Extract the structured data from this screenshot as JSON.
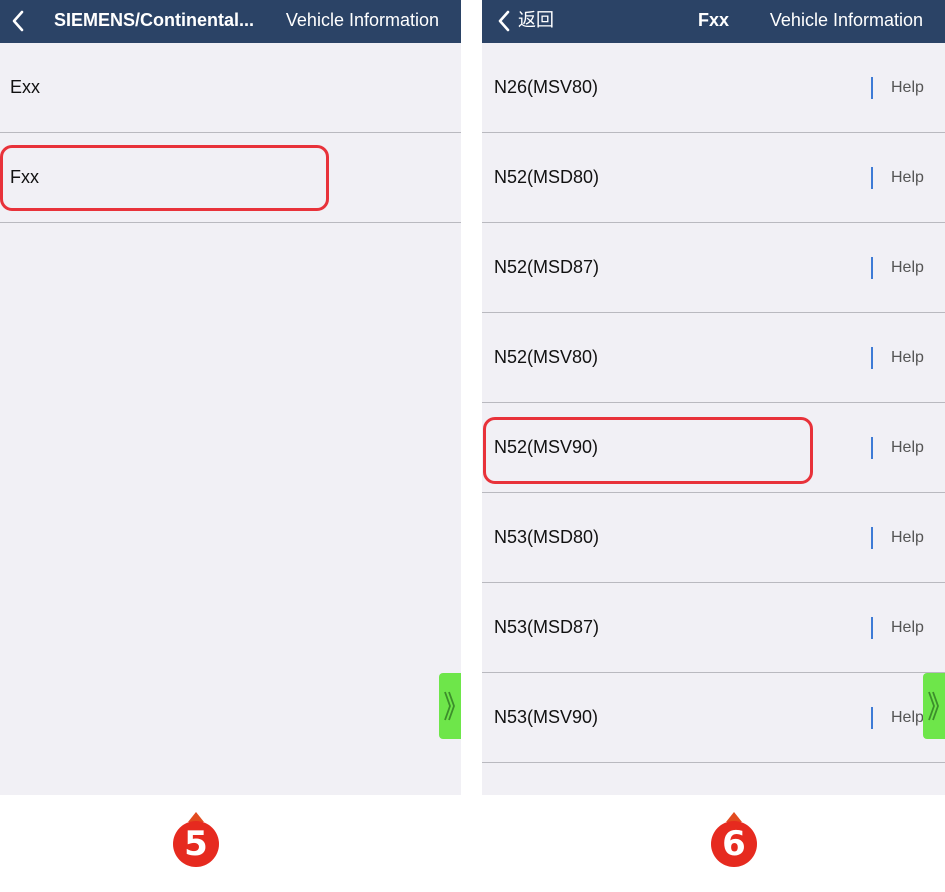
{
  "left_screen": {
    "header": {
      "breadcrumb": "SIEMENS/Continental...",
      "title": "Vehicle Information"
    },
    "list_items": [
      {
        "label": "Exx"
      },
      {
        "label": "Fxx"
      }
    ],
    "highlighted_item": "Fxx",
    "step_number": "5"
  },
  "right_screen": {
    "header": {
      "back_label": "返回",
      "model_title": "Fxx",
      "title": "Vehicle Information"
    },
    "help_label": "Help",
    "list_items": [
      {
        "label": "N26(MSV80)"
      },
      {
        "label": "N52(MSD80)"
      },
      {
        "label": "N52(MSD87)"
      },
      {
        "label": "N52(MSV80)"
      },
      {
        "label": "N52(MSV90)"
      },
      {
        "label": "N53(MSD80)"
      },
      {
        "label": "N53(MSD87)"
      },
      {
        "label": "N53(MSV90)"
      }
    ],
    "highlighted_item": "N52(MSV90)",
    "step_number": "6"
  },
  "colors": {
    "header_bg": "#2b4366",
    "list_bg": "#f1f0f5",
    "highlight": "#e8323a",
    "side_tab": "#6ee64a",
    "help_divider": "#3d7bd6",
    "step_badge": "#e62a1f"
  },
  "icons": {
    "back": "chevron-left-icon",
    "side_tab": "double-chevron-right-icon"
  }
}
